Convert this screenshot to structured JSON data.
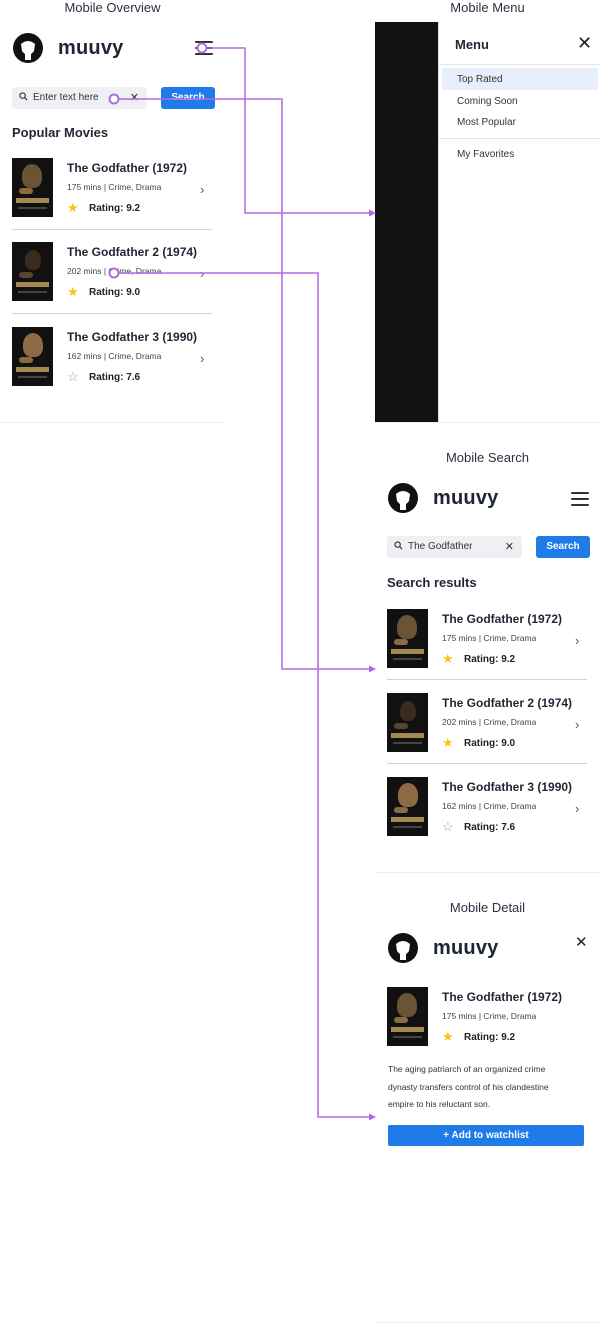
{
  "overview": {
    "label": "Mobile Overview",
    "brand": "muuvy",
    "search": {
      "value": "Enter text here",
      "button": "Search"
    },
    "section_title": "Popular Movies"
  },
  "menu": {
    "label": "Mobile Menu",
    "title": "Menu",
    "items": [
      "Top Rated",
      "Coming Soon",
      "Most Popular"
    ],
    "favorites": "My Favorites"
  },
  "search_screen": {
    "label": "Mobile Search",
    "brand": "muuvy",
    "search": {
      "value": "The Godfather",
      "button": "Search"
    },
    "section_title": "Search results"
  },
  "detail": {
    "label": "Mobile Detail",
    "brand": "muuvy",
    "description_lines": [
      "The aging patriarch of an organized crime",
      "dynasty transfers control of his clandestine",
      "empire to his reluctant son."
    ],
    "watchlist_button": "+ Add to watchlist"
  },
  "movies": [
    {
      "title": "The Godfather  (1972)",
      "meta": "175 mins | Crime, Drama",
      "rating": "Rating: 9.2",
      "starred": true
    },
    {
      "title": "The Godfather 2  (1974)",
      "meta": "202 mins | Crime, Drama",
      "rating": "Rating: 9.0",
      "starred": true
    },
    {
      "title": "The Godfather 3 (1990)",
      "meta": "162 mins | Crime, Drama",
      "rating": "Rating: 7.6",
      "starred": false
    }
  ],
  "icons": {
    "logo": "logo-icon",
    "menu": "hamburger-icon",
    "search": "search-icon",
    "clear": "clear-icon",
    "close": "close-icon",
    "chevron": "chevron-right-icon",
    "star": "star-icon"
  },
  "colors": {
    "accent": "#1e7be8",
    "star": "#f5c518",
    "connector": "#b06be0"
  }
}
